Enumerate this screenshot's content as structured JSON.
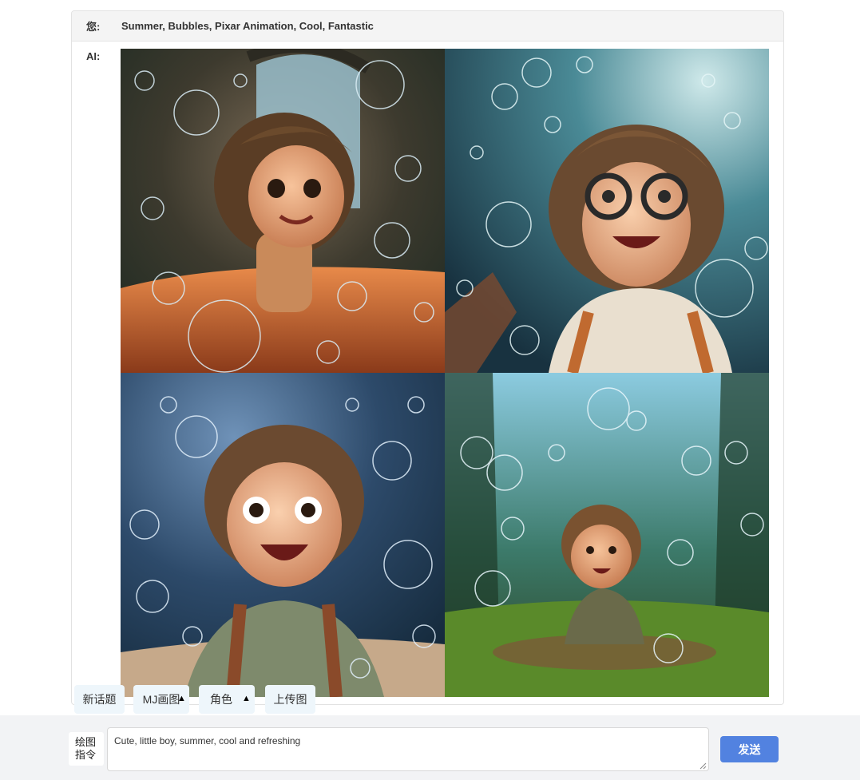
{
  "conversation": {
    "user_label": "您:",
    "user_message": "Summer, Bubbles, Pixar Animation, Cool, Fantastic",
    "ai_label": "AI:"
  },
  "image_grid": [
    {
      "name": "girl-bubbles-warm-window"
    },
    {
      "name": "girl-glasses-bubbles-teal"
    },
    {
      "name": "boy-laughing-bubbles-blue"
    },
    {
      "name": "boy-sitting-forest-bubbles"
    }
  ],
  "toolbar": {
    "new_topic": "新话题",
    "mj_draw": "MJ画图",
    "role": "角色",
    "upload_image": "上传图",
    "caret": "▲"
  },
  "input": {
    "label_line1": "绘图",
    "label_line2": "指令",
    "value": "Cute, little boy, summer, cool and refreshing",
    "send_label": "发送"
  },
  "colors": {
    "send_button": "#5282e0",
    "quick_button_bg": "#eef6fb",
    "bottom_bar": "#f2f3f5"
  }
}
